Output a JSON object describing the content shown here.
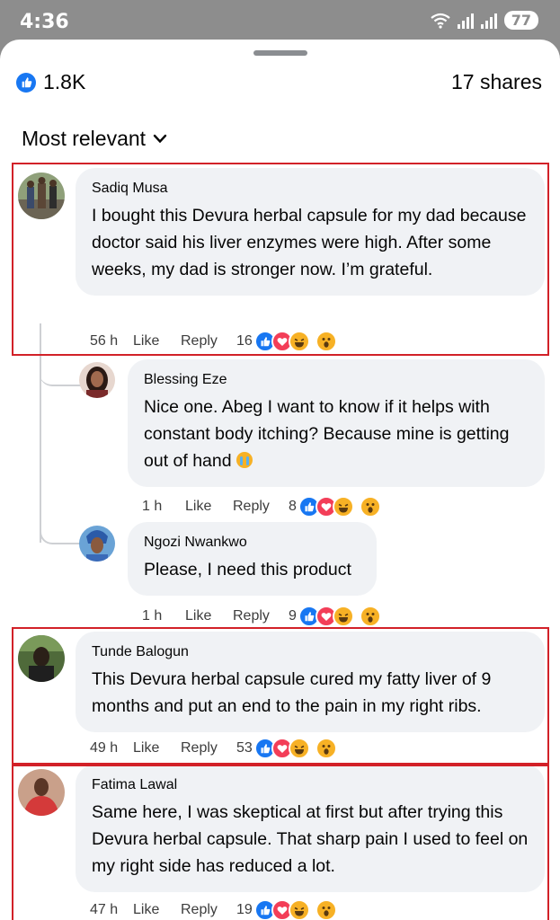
{
  "status": {
    "time": "4:36",
    "battery": "77"
  },
  "summary": {
    "reactions": "1.8K",
    "shares": "17 shares"
  },
  "sort": {
    "label": "Most relevant"
  },
  "comments": [
    {
      "author": "Sadiq Musa",
      "text": "I bought this Devura herbal capsule for my dad because doctor said his liver enzymes were high. After some weeks, my dad is stronger now. I’m grateful.",
      "time": "56 h",
      "like": "Like",
      "reply": "Reply",
      "reaction_count": "16",
      "reactions": [
        "like",
        "love",
        "haha",
        "wow"
      ]
    },
    {
      "author": "Blessing Eze",
      "text": "Nice one. Abeg I want to know if it helps with constant body itching? Because mine is getting out of hand",
      "time": "1 h",
      "like": "Like",
      "reply": "Reply",
      "reaction_count": "8",
      "reactions": [
        "like",
        "love",
        "haha",
        "wow"
      ]
    },
    {
      "author": "Ngozi Nwankwo",
      "text": "Please, I need this product",
      "time": "1 h",
      "like": "Like",
      "reply": "Reply",
      "reaction_count": "9",
      "reactions": [
        "like",
        "love",
        "haha",
        "wow"
      ]
    },
    {
      "author": "Tunde Balogun",
      "text": "This Devura herbal capsule cured my fatty liver of 9 months and put an end to the pain in my right ribs.",
      "time": "49 h",
      "like": "Like",
      "reply": "Reply",
      "reaction_count": "53",
      "reactions": [
        "like",
        "love",
        "haha",
        "wow"
      ]
    },
    {
      "author": "Fatima Lawal",
      "text": "Same here, I was skeptical at first but after trying this Devura herbal capsule. That sharp pain I used to feel on my right side has reduced a lot.",
      "time": "47 h",
      "like": "Like",
      "reply": "Reply",
      "reaction_count": "19",
      "reactions": [
        "like",
        "love",
        "haha",
        "wow"
      ]
    }
  ],
  "colors": {
    "accent": "#1877f2",
    "highlight": "#d22128",
    "bubble": "#f0f2f5"
  }
}
